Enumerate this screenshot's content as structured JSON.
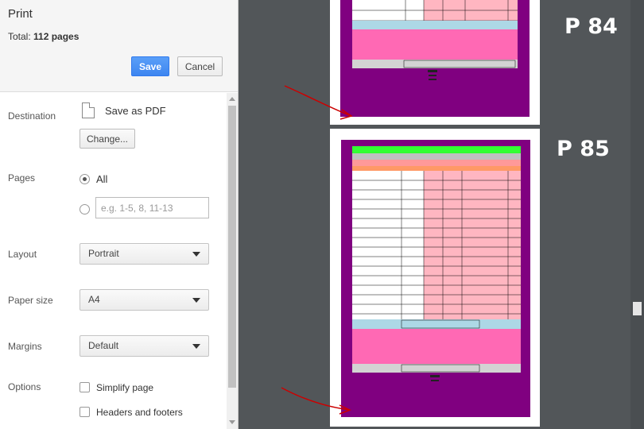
{
  "dialog": {
    "title": "Print",
    "total_prefix": "Total: ",
    "total_value": "112 pages",
    "save_label": "Save",
    "cancel_label": "Cancel"
  },
  "destination": {
    "label": "Destination",
    "value": "Save as PDF",
    "change_label": "Change..."
  },
  "pages": {
    "label": "Pages",
    "all_label": "All",
    "all_selected": true,
    "range_placeholder": "e.g. 1-5, 8, 11-13"
  },
  "layout": {
    "label": "Layout",
    "value": "Portrait"
  },
  "paper_size": {
    "label": "Paper size",
    "value": "A4"
  },
  "margins": {
    "label": "Margins",
    "value": "Default"
  },
  "options": {
    "label": "Options",
    "items": [
      {
        "label": "Simplify page",
        "checked": false
      },
      {
        "label": "Headers and footers",
        "checked": false
      }
    ]
  },
  "preview": {
    "annotations": [
      "P 84",
      "P 85"
    ],
    "colors": {
      "background": "#525659",
      "page_fill": "#800080",
      "annotation_arrow": "#cc0000",
      "header_green": "#33ff33",
      "row_pink": "#ffb6c1"
    }
  }
}
